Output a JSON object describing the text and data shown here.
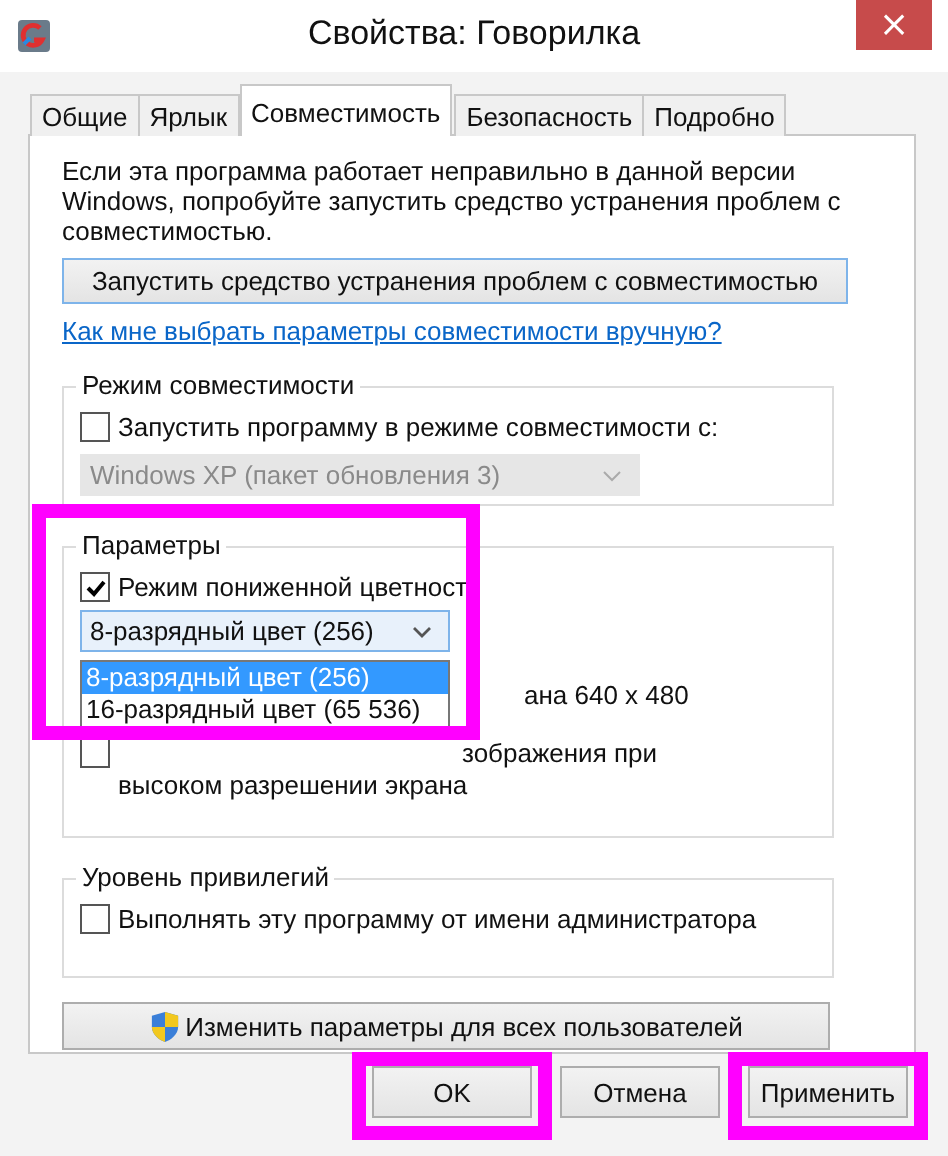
{
  "window": {
    "title": "Свойства: Говорилка",
    "close": "×"
  },
  "tabs": [
    {
      "label": "Общие",
      "selected": false
    },
    {
      "label": "Ярлык",
      "selected": false
    },
    {
      "label": "Совместимость",
      "selected": true
    },
    {
      "label": "Безопасность",
      "selected": false
    },
    {
      "label": "Подробно",
      "selected": false
    }
  ],
  "description": "Если эта программа работает неправильно в данной версии Windows, попробуйте запустить средство устранения проблем с совместимостью.",
  "troubleshoot_button": "Запустить средство устранения проблем с совместимостью",
  "help_link": "Как мне выбрать параметры совместимости вручную?",
  "compat_mode": {
    "title": "Режим совместимости",
    "checkbox": {
      "label": "Запустить программу в режиме совместимости с:",
      "checked": false
    },
    "os_select": {
      "value": "Windows XP (пакет обновления 3)",
      "disabled": true
    }
  },
  "settings": {
    "title": "Параметры",
    "highlighted": true,
    "reduced_color": {
      "label": "Режим пониженной цветност",
      "checked": true
    },
    "color_select": {
      "value": "8-разрядный цвет (256)",
      "expanded": true,
      "options": [
        {
          "label": "8-разрядный цвет (256)",
          "selected": true
        },
        {
          "label": "16-разрядный цвет (65 536)",
          "selected": false
        }
      ]
    },
    "partial_rows": [
      {
        "kind": "text",
        "lines": [
          "ана 640 x 480"
        ]
      },
      {
        "kind": "checkbox",
        "checked": false,
        "lines": [
          "зображения при",
          "высоком разрешении экрана"
        ]
      }
    ]
  },
  "privilege": {
    "title": "Уровень привилегий",
    "checkbox": {
      "label": "Выполнять эту программу от имени администратора",
      "checked": false
    }
  },
  "all_users_button": "Изменить параметры для всех пользователей",
  "buttons": [
    {
      "label": "OK",
      "highlighted": true
    },
    {
      "label": "Отмена",
      "highlighted": false
    },
    {
      "label": "Применить",
      "highlighted": true
    }
  ]
}
